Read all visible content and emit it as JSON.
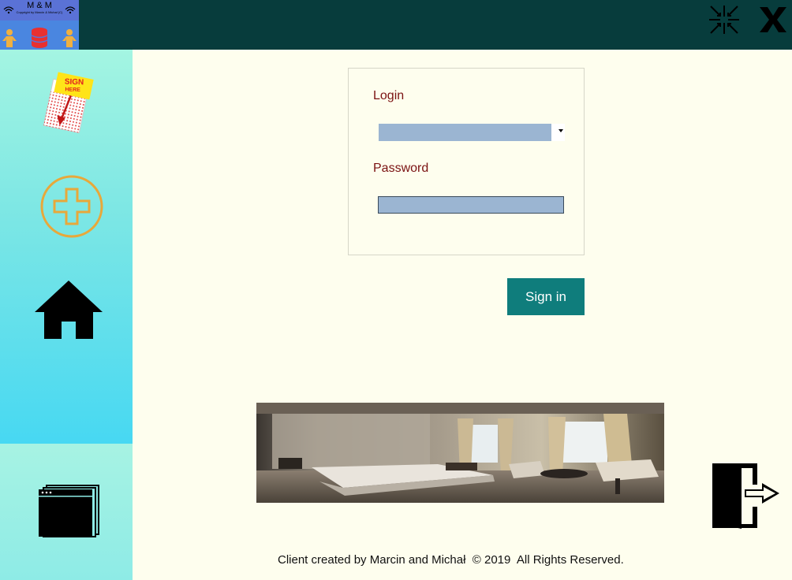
{
  "app": {
    "logo_title": "M & M",
    "logo_copyright": "Copyright by Marcin & Michał (C)"
  },
  "window_controls": {
    "minimize_icon": "collapse-arrows-icon",
    "close_icon": "close-x-icon"
  },
  "sidebar": {
    "items": [
      {
        "name": "sign-here",
        "icon": "sign-here-icon",
        "text": "SIGN HERE"
      },
      {
        "name": "add",
        "icon": "plus-circle-icon"
      },
      {
        "name": "home",
        "icon": "home-icon"
      },
      {
        "name": "windows",
        "icon": "windows-stack-icon"
      }
    ]
  },
  "login_form": {
    "login_label": "Login",
    "login_value": "",
    "password_label": "Password",
    "password_value": "",
    "submit_label": "Sign in"
  },
  "footer": {
    "text": "Client created by Marcin and Michał  © 2019  All Rights Reserved."
  },
  "colors": {
    "topbar": "#073c3c",
    "page_bg": "#fefeee",
    "label_text": "#7b1212",
    "input_fill": "#9bb5d2",
    "button_bg": "#0f7d7c",
    "plus_ring": "#e8a83a"
  }
}
